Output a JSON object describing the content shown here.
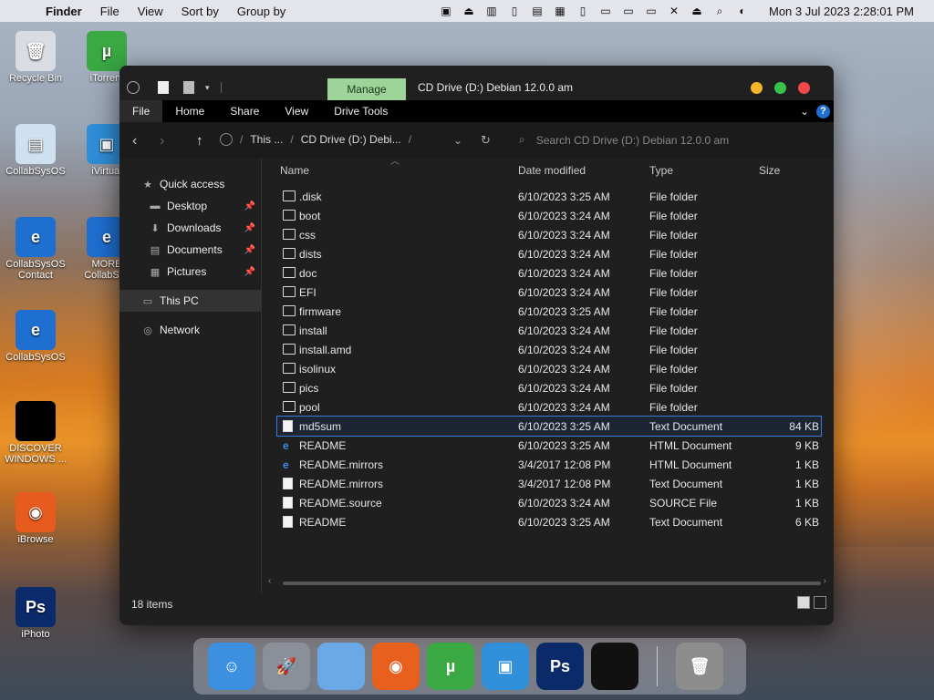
{
  "menubar": {
    "app": "Finder",
    "items": [
      "File",
      "View",
      "Sort by",
      "Group by"
    ],
    "clock": "Mon 3 Jul 2023  2:28:01 PM",
    "status_icons": [
      "printer-icon",
      "eject-circle-icon",
      "mem-icon",
      "battery-icon",
      "ssd-icon",
      "cpu-icon",
      "phone-icon",
      "sidebar-icon",
      "drive-icon",
      "display-icon",
      "mute-icon",
      "eject-icon",
      "search-icon",
      "control-center-icon"
    ]
  },
  "desktop": {
    "icons": [
      {
        "label": "Recycle Bin",
        "color": "#d9dde3",
        "glyph": "🗑"
      },
      {
        "label": "iTorrent",
        "color": "#3aa843",
        "glyph": "µ"
      },
      {
        "label": "CollabSysOS",
        "color": "#cfe0f0",
        "glyph": "▤"
      },
      {
        "label": "iVirtual",
        "color": "#2f8fd8",
        "glyph": "▣"
      },
      {
        "label": "CollabSysOS Contact",
        "color": "#1e6fd0",
        "glyph": "e"
      },
      {
        "label": "MORE CollabSys",
        "color": "#1e6fd0",
        "glyph": "e"
      },
      {
        "label": "CollabSysOS",
        "color": "#1e6fd0",
        "glyph": "e"
      },
      {
        "label": "DISCOVER WINDOWS ...",
        "color": "#000000",
        "glyph": ""
      },
      {
        "label": "iBrowse",
        "color": "#e85b1e",
        "glyph": "◉"
      },
      {
        "label": "iPhoto",
        "color": "#0a2a6a",
        "glyph": "Ps"
      }
    ]
  },
  "window": {
    "manage_tab": "Manage",
    "title": "CD Drive (D:) Debian 12.0.0 am",
    "ribbon_tabs": [
      "File",
      "Home",
      "Share",
      "View",
      "Drive Tools"
    ],
    "breadcrumb": [
      "This ...",
      "CD Drive (D:) Debi..."
    ],
    "search_placeholder": "Search CD Drive (D:) Debian 12.0.0 am",
    "sidebar": [
      {
        "label": "Quick access",
        "icon": "star-icon",
        "pinned": false,
        "indent": 1
      },
      {
        "label": "Desktop",
        "icon": "desktop-folder-icon",
        "pinned": true,
        "indent": 2
      },
      {
        "label": "Downloads",
        "icon": "download-icon",
        "pinned": true,
        "indent": 2
      },
      {
        "label": "Documents",
        "icon": "documents-icon",
        "pinned": true,
        "indent": 2
      },
      {
        "label": "Pictures",
        "icon": "pictures-icon",
        "pinned": true,
        "indent": 2
      },
      {
        "label": "This PC",
        "icon": "computer-icon",
        "pinned": false,
        "indent": 1,
        "selected": true
      },
      {
        "label": "Network",
        "icon": "network-icon",
        "pinned": false,
        "indent": 1
      }
    ],
    "columns": {
      "name": "Name",
      "date": "Date modified",
      "type": "Type",
      "size": "Size"
    },
    "files": [
      {
        "name": ".disk",
        "date": "6/10/2023 3:25 AM",
        "type": "File folder",
        "size": "",
        "kind": "folder"
      },
      {
        "name": "boot",
        "date": "6/10/2023 3:24 AM",
        "type": "File folder",
        "size": "",
        "kind": "folder"
      },
      {
        "name": "css",
        "date": "6/10/2023 3:24 AM",
        "type": "File folder",
        "size": "",
        "kind": "folder"
      },
      {
        "name": "dists",
        "date": "6/10/2023 3:24 AM",
        "type": "File folder",
        "size": "",
        "kind": "folder"
      },
      {
        "name": "doc",
        "date": "6/10/2023 3:24 AM",
        "type": "File folder",
        "size": "",
        "kind": "folder"
      },
      {
        "name": "EFI",
        "date": "6/10/2023 3:24 AM",
        "type": "File folder",
        "size": "",
        "kind": "folder"
      },
      {
        "name": "firmware",
        "date": "6/10/2023 3:25 AM",
        "type": "File folder",
        "size": "",
        "kind": "folder"
      },
      {
        "name": "install",
        "date": "6/10/2023 3:24 AM",
        "type": "File folder",
        "size": "",
        "kind": "folder"
      },
      {
        "name": "install.amd",
        "date": "6/10/2023 3:24 AM",
        "type": "File folder",
        "size": "",
        "kind": "folder"
      },
      {
        "name": "isolinux",
        "date": "6/10/2023 3:24 AM",
        "type": "File folder",
        "size": "",
        "kind": "folder"
      },
      {
        "name": "pics",
        "date": "6/10/2023 3:24 AM",
        "type": "File folder",
        "size": "",
        "kind": "folder"
      },
      {
        "name": "pool",
        "date": "6/10/2023 3:24 AM",
        "type": "File folder",
        "size": "",
        "kind": "folder"
      },
      {
        "name": "md5sum",
        "date": "6/10/2023 3:25 AM",
        "type": "Text Document",
        "size": "84 KB",
        "kind": "doc",
        "selected": true
      },
      {
        "name": "README",
        "date": "6/10/2023 3:25 AM",
        "type": "HTML Document",
        "size": "9 KB",
        "kind": "html"
      },
      {
        "name": "README.mirrors",
        "date": "3/4/2017 12:08 PM",
        "type": "HTML Document",
        "size": "1 KB",
        "kind": "html"
      },
      {
        "name": "README.mirrors",
        "date": "3/4/2017 12:08 PM",
        "type": "Text Document",
        "size": "1 KB",
        "kind": "doc"
      },
      {
        "name": "README.source",
        "date": "6/10/2023 3:24 AM",
        "type": "SOURCE File",
        "size": "1 KB",
        "kind": "doc"
      },
      {
        "name": "README",
        "date": "6/10/2023 3:25 AM",
        "type": "Text Document",
        "size": "6 KB",
        "kind": "doc"
      }
    ],
    "status": "18 items"
  },
  "dock": [
    {
      "name": "finder-dock-icon",
      "color": "#3d8fe0",
      "glyph": "☺"
    },
    {
      "name": "launchpad-dock-icon",
      "color": "#8a8f98",
      "glyph": "🚀"
    },
    {
      "name": "folder-dock-icon",
      "color": "#6aa8e8",
      "glyph": ""
    },
    {
      "name": "firefox-dock-icon",
      "color": "#e8601e",
      "glyph": "◉"
    },
    {
      "name": "utorrent-dock-icon",
      "color": "#3aa843",
      "glyph": "µ"
    },
    {
      "name": "virtual-dock-icon",
      "color": "#2f8fd8",
      "glyph": "▣"
    },
    {
      "name": "photoshop-dock-icon",
      "color": "#0a2a6a",
      "glyph": "Ps"
    },
    {
      "name": "apple-dock-icon",
      "color": "#111111",
      "glyph": ""
    },
    {
      "name": "trash-dock-icon",
      "color": "#8d8d8d",
      "glyph": "🗑"
    }
  ]
}
